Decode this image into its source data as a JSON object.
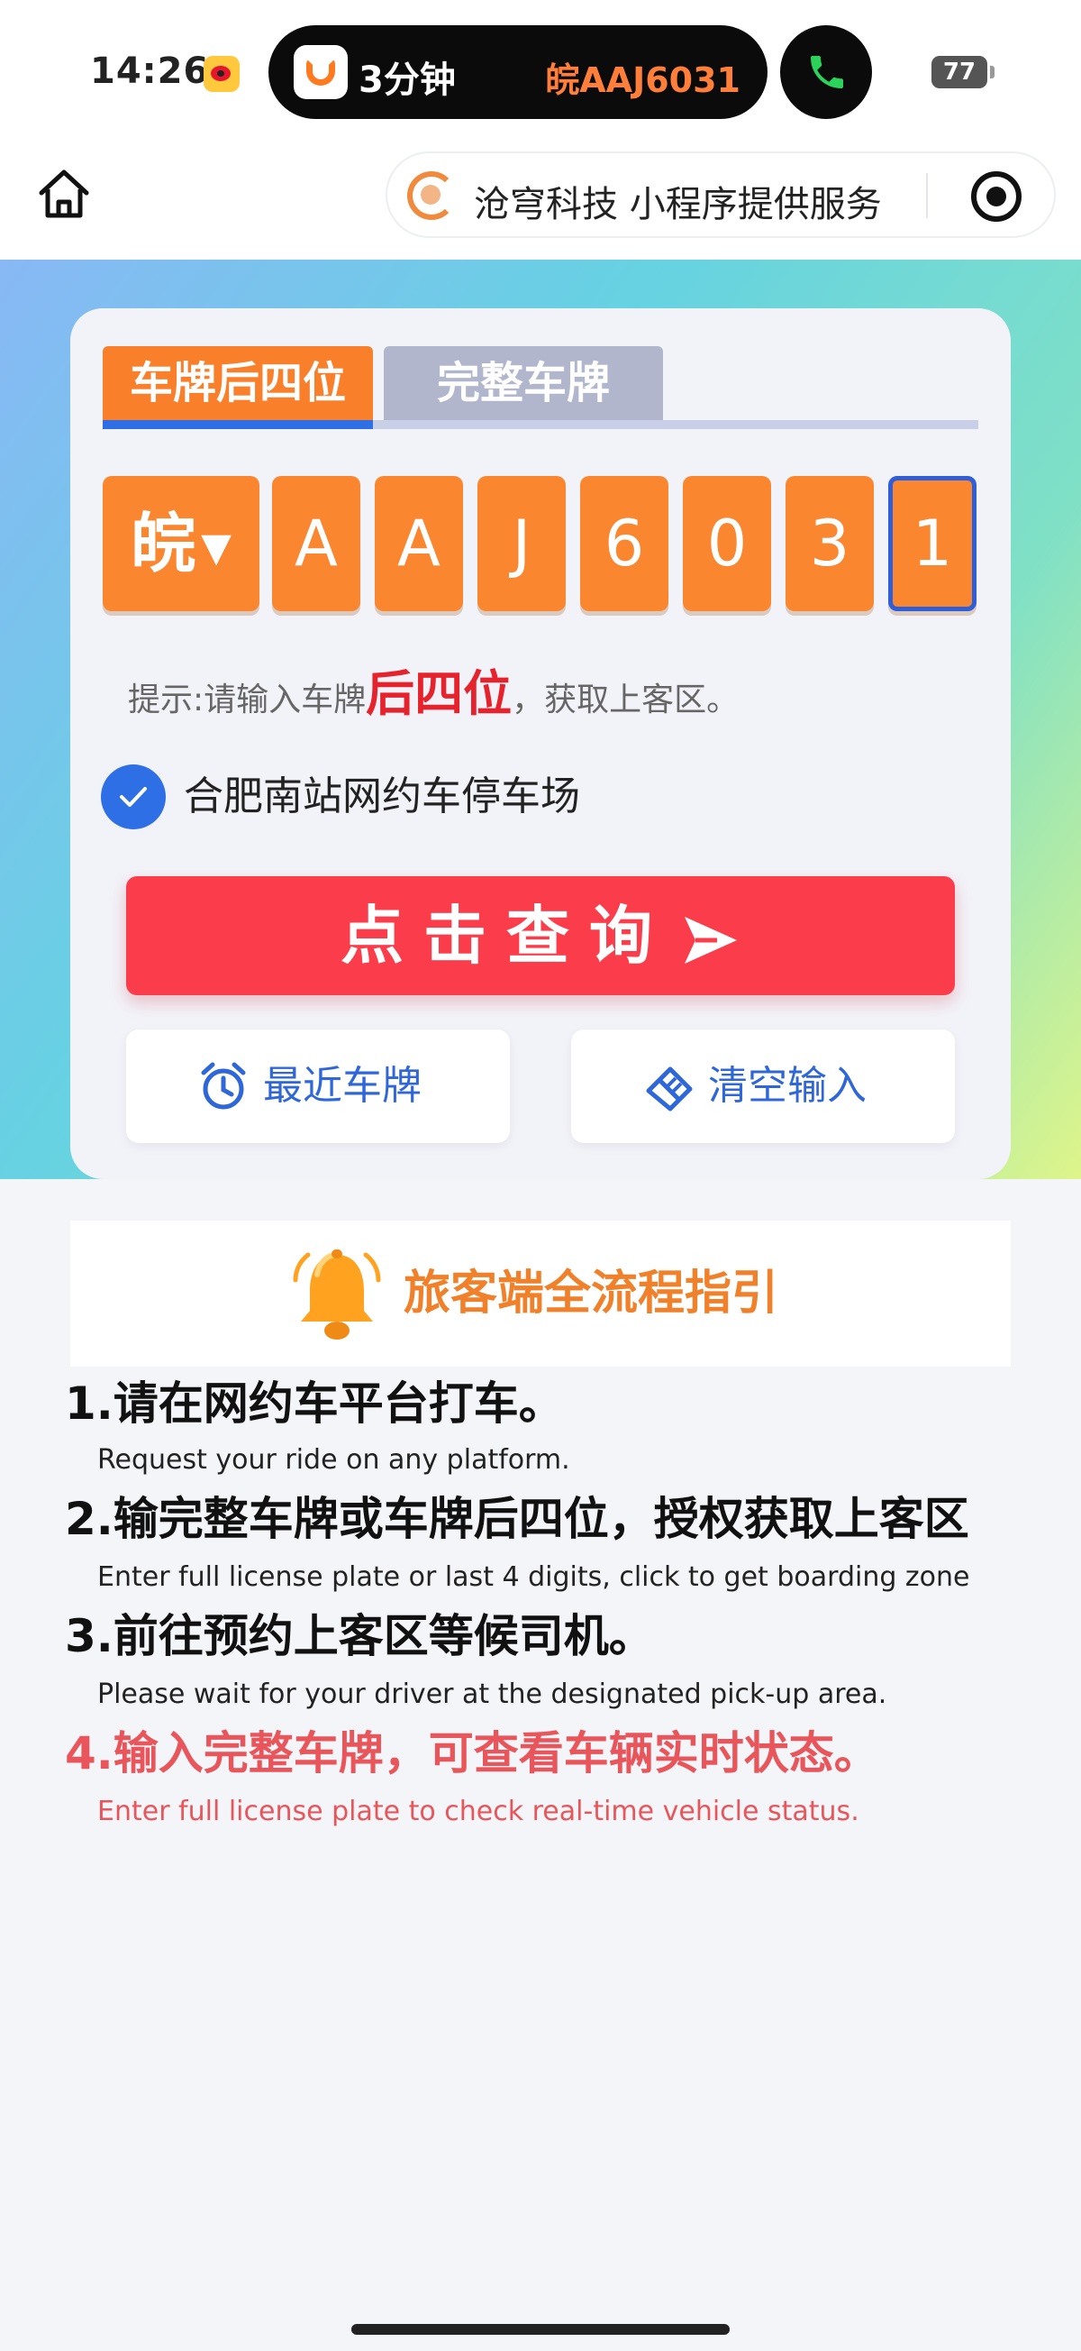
{
  "status_bar": {
    "time": "14:26",
    "island_minutes": "3分钟",
    "island_plate": "皖AAJ6031",
    "battery": "77"
  },
  "nav": {
    "provider_text": "沧穹科技 小程序提供服务"
  },
  "plate_form": {
    "tabs": [
      {
        "label": "车牌后四位",
        "active": true
      },
      {
        "label": "完整车牌",
        "active": false
      }
    ],
    "province": "皖",
    "province_caret": "▼",
    "characters": [
      "A",
      "A",
      "J",
      "6",
      "0",
      "3",
      "1"
    ],
    "hint_prefix": "提示:请输入车牌",
    "hint_emphasis": "后四位",
    "hint_suffix": "，获取上客区。",
    "station": "合肥南站网约车停车场",
    "query_label": "点击查询",
    "recent_label": "最近车牌",
    "clear_label": "清空输入"
  },
  "guide": {
    "title": "旅客端全流程指引",
    "steps": [
      {
        "cn": "1.请在网约车平台打车。",
        "en": "Request your ride on any platform."
      },
      {
        "cn": "2.输完整车牌或车牌后四位，授权获取上客区",
        "en": "Enter full license plate or last 4 digits, click to get boarding zone"
      },
      {
        "cn": "3.前往预约上客区等候司机。",
        "en": "Please wait for your driver at the designated pick-up area."
      },
      {
        "cn": "4.输入完整车牌，可查看车辆实时状态。",
        "en": "Enter full license plate to check real-time vehicle status."
      }
    ]
  },
  "colors": {
    "accent_orange": "#fa862f",
    "tab_active_underline": "#2f6fe6",
    "query_red": "#fb3d4b",
    "step4_red": "#e8555a"
  },
  "icons": {
    "home": "home-icon",
    "target": "target-icon",
    "check": "check-icon",
    "send": "send-icon",
    "clock": "alarm-clock-icon",
    "eraser": "eraser-icon",
    "bell": "bell-icon",
    "phone": "phone-icon"
  }
}
